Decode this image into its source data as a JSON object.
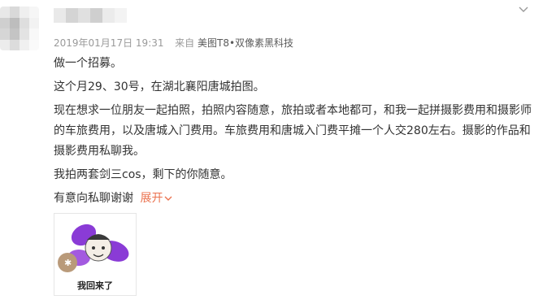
{
  "post": {
    "meta": {
      "date": "2019年01月17日",
      "time": "19:31",
      "via": "来自",
      "client": "美图T8•双像素黑科技"
    },
    "paragraphs": [
      "做一个招募。",
      "这个月29、30号，在湖北襄阳唐城拍图。",
      "现在想求一位朋友一起拍照，拍照内容随意，旅拍或者本地都可，和我一起拼摄影费用和摄影师的车旅费用，以及唐城入门费用。车旅费用和唐城入门费平摊一个人交280左右。摄影的作品和摄影费用私聊我。",
      "我拍两套剑三cos，剩下的你随意。"
    ],
    "last_line": "有意向私聊谢谢",
    "expand_label": "展开",
    "image": {
      "caption": "我回来了",
      "icon": "meme-sticker"
    }
  },
  "colors": {
    "text": "#333333",
    "meta": "#9a9a9a",
    "accent": "#eb7350",
    "purple": "#8a3bd6"
  }
}
